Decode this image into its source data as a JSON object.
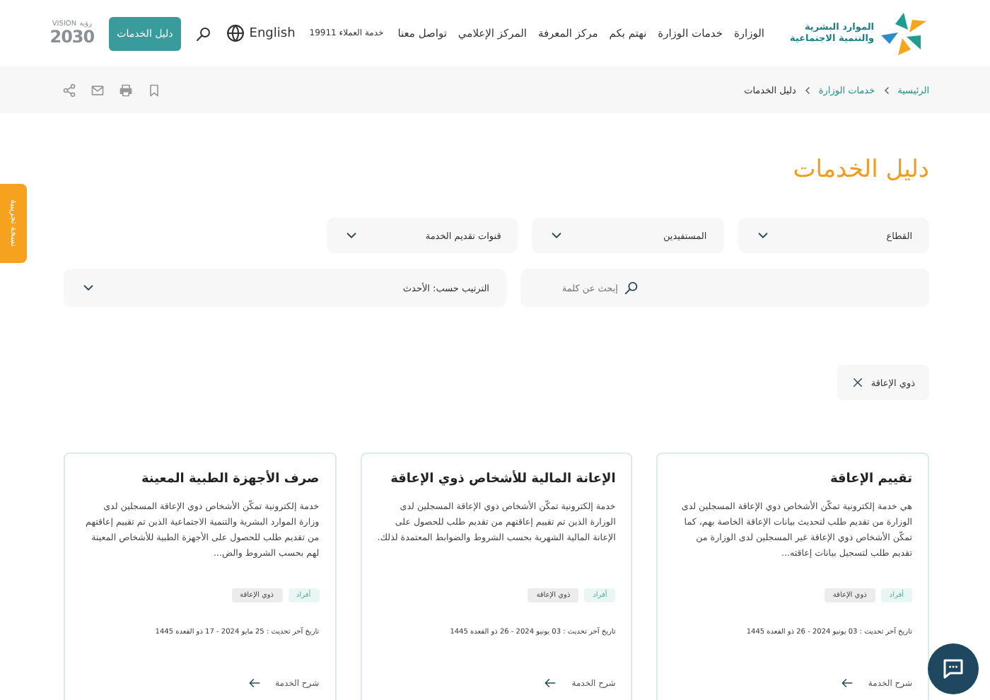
{
  "header": {
    "logo": {
      "line1": "الموارد البشرية",
      "line2": "والتنمية الاجتماعية"
    },
    "nav": [
      {
        "label": "الوزارة"
      },
      {
        "label": "خدمات الوزارة"
      },
      {
        "label": "نهتم بكم"
      },
      {
        "label": "مركز المعرفة"
      },
      {
        "label": "المركز الإعلامي"
      },
      {
        "label": "تواصل معنا"
      }
    ],
    "hotline": "خدمة العملاء 19911",
    "language": "English",
    "cta": "دليل الخدمات",
    "vision": {
      "label": "VISION",
      "arabic": "رؤية",
      "year": "2030"
    }
  },
  "breadcrumb": [
    {
      "label": "الرئيسية",
      "current": false
    },
    {
      "label": "خدمات الوزارة",
      "current": false
    },
    {
      "label": "دليل الخدمات",
      "current": true
    }
  ],
  "beta_tab": "نسخة تجريبية",
  "title": "دليل الخدمات",
  "filters": [
    {
      "label": "القطاع"
    },
    {
      "label": "المستفيدين"
    },
    {
      "label": "قنوات تقديم الخدمة"
    }
  ],
  "search": {
    "placeholder": "إبحث عن كلمة"
  },
  "sort": {
    "label": "الترتيب حسب: الأحدث"
  },
  "active_filters": [
    {
      "label": "ذوي الإعاقة"
    }
  ],
  "cards": [
    {
      "title": "تقييم الإعاقة",
      "description": "هي خدمة إلكترونية تمكّن الأشخاص ذوي الإعاقة المسجلين لدى الوزارة من تقديم طلب لتحديث بيانات الإعاقة الخاصة بهم، كما تمكّن الأشخاص ذوي الإعاقة غير المسجلين لدى الوزارة من تقديم طلب لتسجيل بيانات إعاقته...",
      "tags": [
        {
          "label": "أفراد",
          "kind": "audience"
        },
        {
          "label": "ذوي الإعاقة",
          "kind": "category"
        }
      ],
      "updated": "تاريخ آخر تحديث : 03 يونيو 2024 - 26 ذو القعدة 1445",
      "link": "شرح الخدمة"
    },
    {
      "title": "الإعانة المالية للأشخاص ذوي الإعاقة",
      "description": "خدمة إلكترونية تمكّن الأشخاص ذوي الإعاقة المسجلين لدى الوزارة الذين تم تقييم إعاقتهم من تقديم طلب للحصول على الإعانة المالية الشهرية بحسب الشروط والضوابط المعتمدة لذلك.",
      "tags": [
        {
          "label": "أفراد",
          "kind": "audience"
        },
        {
          "label": "ذوي الإعاقة",
          "kind": "category"
        }
      ],
      "updated": "تاريخ آخر تحديث : 03 يونيو 2024 - 26 ذو القعدة 1445",
      "link": "شرح الخدمة"
    },
    {
      "title": "صرف الأجهزة الطبية المعينة",
      "description": "خدمة إلكترونية تمكّن الأشخاص ذوي الإعاقة المسجلين لدى وزارة الموارد البشرية والتنمية الاجتماعية الذين تم تقييم إعاقتهم من تقديم طلب للحصول على الأجهزة الطبية للأشخاص المعينة لهم بحسب الشروط والض...",
      "tags": [
        {
          "label": "أفراد",
          "kind": "audience"
        },
        {
          "label": "ذوي الإعاقة",
          "kind": "category"
        }
      ],
      "updated": "تاريخ آخر تحديث : 25 مايو 2024 - 17 ذو القعدة 1445",
      "link": "شرح الخدمة"
    }
  ]
}
